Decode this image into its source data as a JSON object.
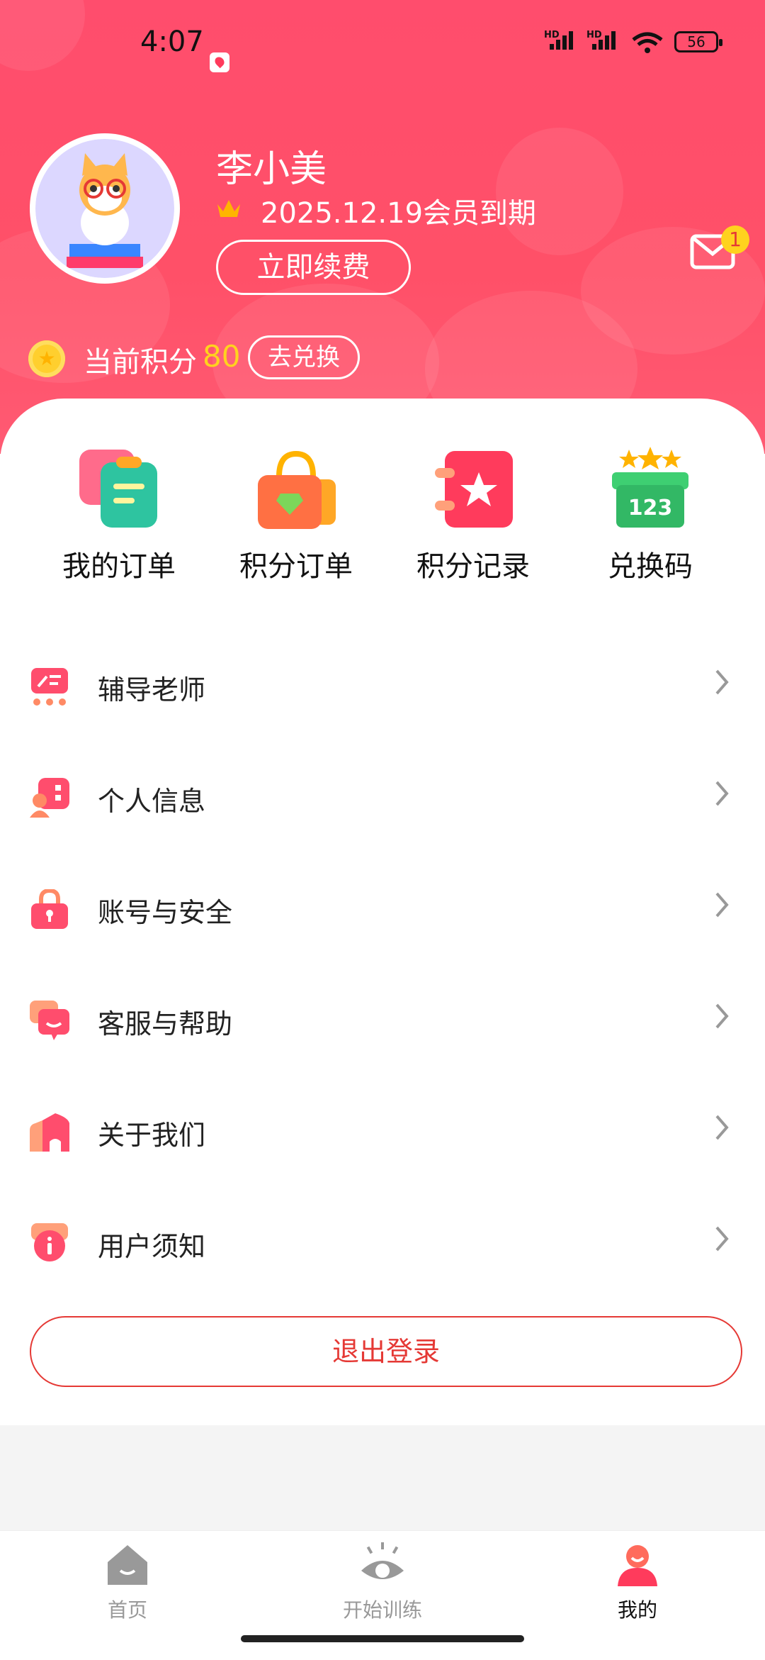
{
  "status_bar": {
    "time": "4:07",
    "sim1": "HD",
    "sim2": "HD",
    "battery": "56"
  },
  "profile": {
    "name": "李小美",
    "membership": "2025.12.19会员到期",
    "renew_label": "立即续费",
    "mail_badge": "1"
  },
  "points": {
    "label": "当前积分",
    "value": "80",
    "exchange_label": "去兑换"
  },
  "quick_actions": [
    {
      "label": "我的订单",
      "icon": "order-icon"
    },
    {
      "label": "积分订单",
      "icon": "shopping-bag-icon"
    },
    {
      "label": "积分记录",
      "icon": "star-notebook-icon"
    },
    {
      "label": "兑换码",
      "icon": "redeem-code-icon"
    }
  ],
  "menu": [
    {
      "label": "辅导老师",
      "icon": "teacher-icon"
    },
    {
      "label": "个人信息",
      "icon": "profile-info-icon"
    },
    {
      "label": "账号与安全",
      "icon": "lock-icon"
    },
    {
      "label": "客服与帮助",
      "icon": "chat-support-icon"
    },
    {
      "label": "关于我们",
      "icon": "house-icon"
    },
    {
      "label": "用户须知",
      "icon": "info-icon"
    }
  ],
  "logout_label": "退出登录",
  "tabs": [
    {
      "label": "首页",
      "icon": "home-icon"
    },
    {
      "label": "开始训练",
      "icon": "eye-icon"
    },
    {
      "label": "我的",
      "icon": "user-icon"
    }
  ],
  "colors": {
    "primary": "#ff4d6d",
    "accent_yellow": "#ffd21e",
    "logout_red": "#e53935"
  }
}
